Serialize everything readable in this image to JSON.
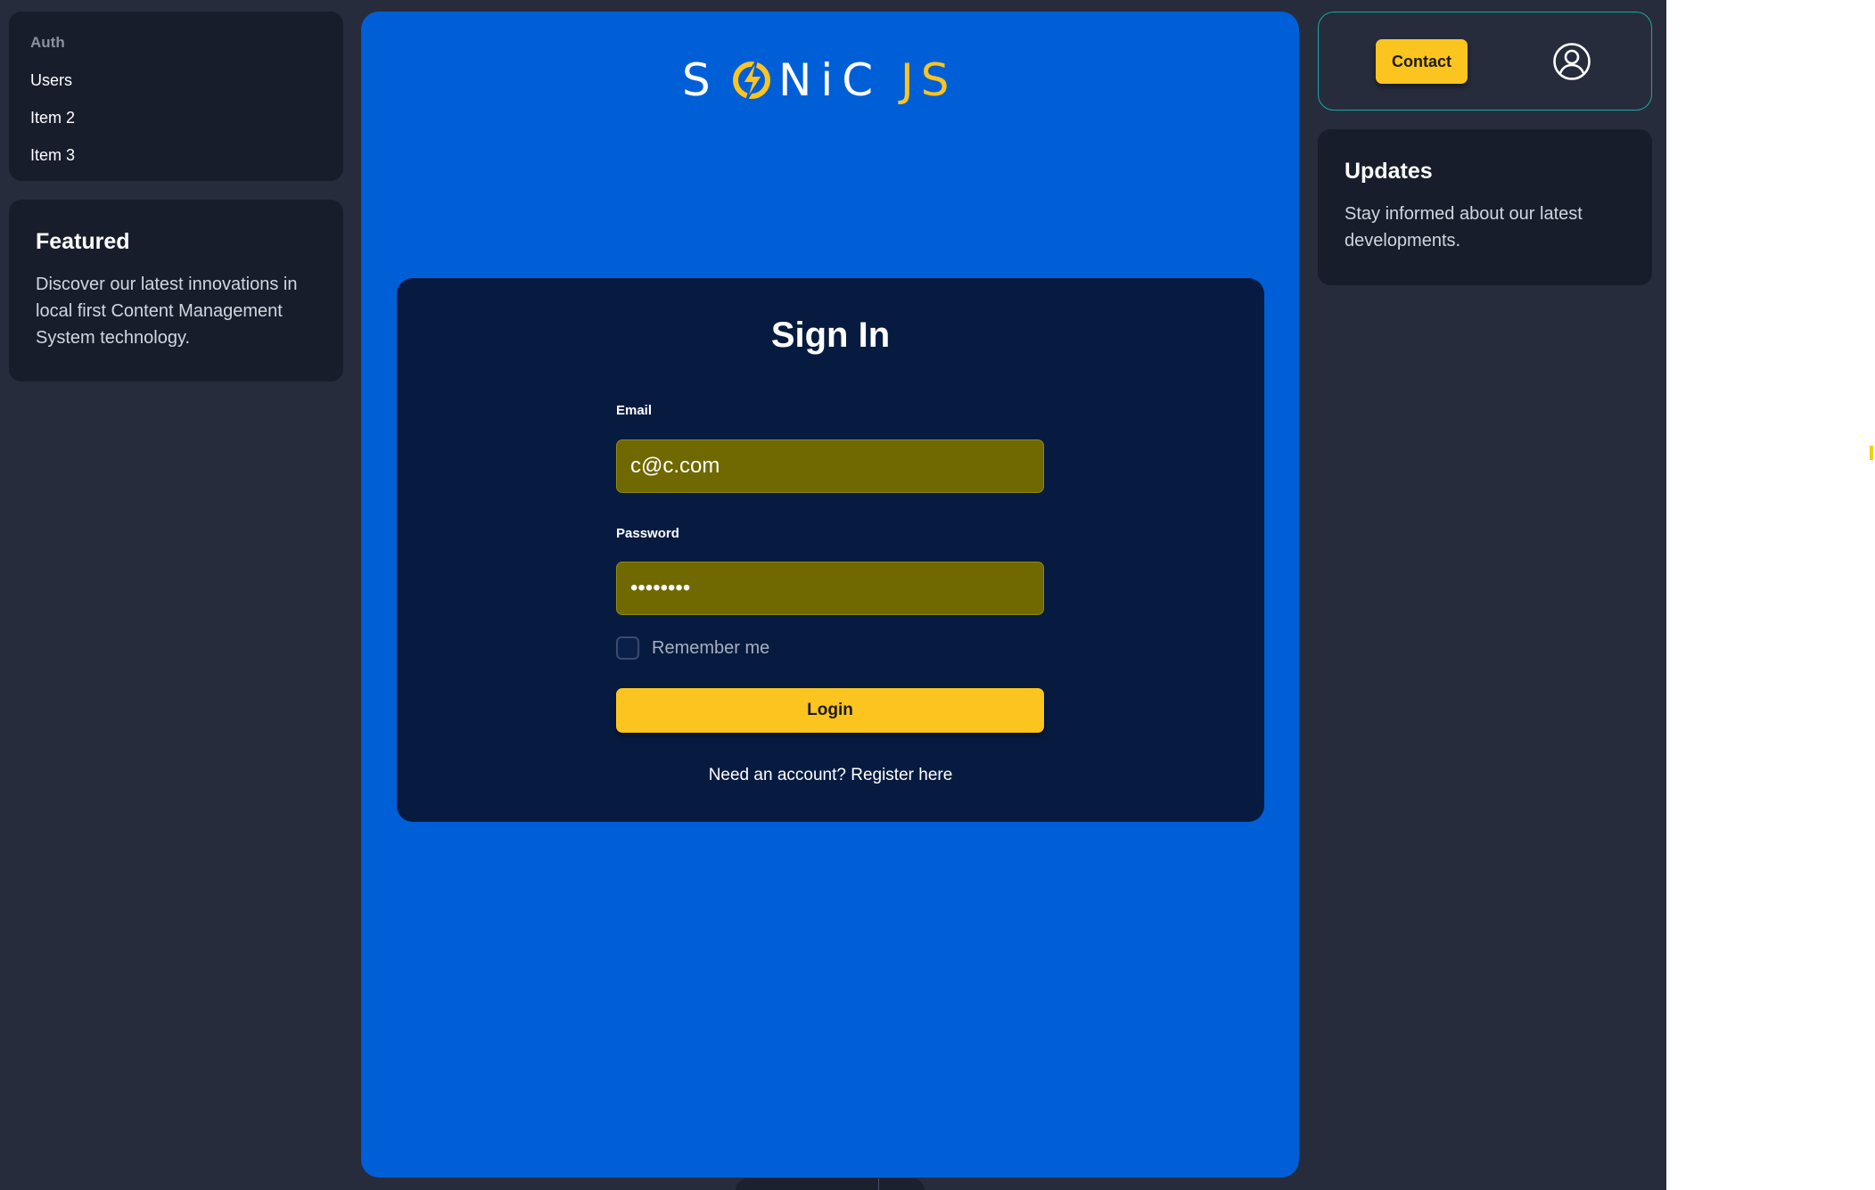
{
  "sidebar": {
    "group_label": "Auth",
    "items": [
      {
        "label": "Users"
      },
      {
        "label": "Item 2"
      },
      {
        "label": "Item 3"
      }
    ]
  },
  "featured": {
    "title": "Featured",
    "text": "Discover our latest innovations in local first Content Management System technology."
  },
  "logo": {
    "part1": "S",
    "part2": "NiC",
    "part3": "JS",
    "colors": {
      "white": "#ffffff",
      "yellow": "#fcc41f"
    }
  },
  "signin": {
    "title": "Sign In",
    "email_label": "Email",
    "email_value": "c@c.com",
    "password_label": "Password",
    "password_value": "••••••••",
    "remember_label": "Remember me",
    "remember_checked": false,
    "login_label": "Login",
    "register_prefix": "Need an account? ",
    "register_link": "Register here"
  },
  "header": {
    "contact_label": "Contact",
    "user_icon": "user-circle-icon"
  },
  "updates": {
    "title": "Updates",
    "text": "Stay informed about our latest developments."
  },
  "colors": {
    "background": "#262c3c",
    "card": "#181d2c",
    "panel": "#005fd6",
    "signin_card": "#071b40",
    "accent": "#fcc41f",
    "input_fill": "#706800",
    "header_border": "#1ba6a6"
  }
}
